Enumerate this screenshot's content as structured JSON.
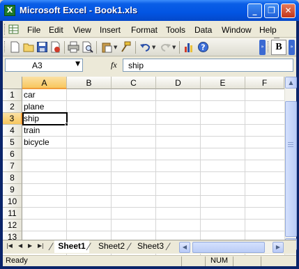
{
  "window": {
    "title": "Microsoft Excel - Book1.xls",
    "minimize": "_",
    "restore": "❐",
    "close": "✕"
  },
  "menu": {
    "items": [
      "File",
      "Edit",
      "View",
      "Insert",
      "Format",
      "Tools",
      "Data",
      "Window",
      "Help"
    ],
    "mdi_minimize": "_",
    "mdi_restore": "❐",
    "mdi_close": "✕"
  },
  "toolbar": {
    "icons": [
      "new-icon",
      "open-icon",
      "save-icon",
      "permission-icon",
      "print-icon",
      "print-preview-icon",
      "paste-icon",
      "format-painter-icon",
      "undo-icon",
      "redo-icon",
      "chart-wizard-icon",
      "help-icon"
    ],
    "bold_label": "B"
  },
  "formula_bar": {
    "name_box": "A3",
    "fx_label": "fx",
    "value": "ship"
  },
  "grid": {
    "columns": [
      "A",
      "B",
      "C",
      "D",
      "E",
      "F"
    ],
    "rows": [
      "1",
      "2",
      "3",
      "4",
      "5",
      "6",
      "7",
      "8",
      "9",
      "10",
      "11",
      "12",
      "13"
    ],
    "active_column": "A",
    "active_row": "3",
    "cells_A": [
      "car",
      "plane",
      "ship",
      "train",
      "bicycle"
    ]
  },
  "sheets": {
    "tabs": [
      "Sheet1",
      "Sheet2",
      "Sheet3"
    ],
    "active": "Sheet1"
  },
  "status": {
    "left": "Ready",
    "num": "NUM"
  },
  "colors": {
    "title_bar": "#0255e3",
    "active_header": "#f8c75e",
    "chrome": "#ece9d8"
  }
}
